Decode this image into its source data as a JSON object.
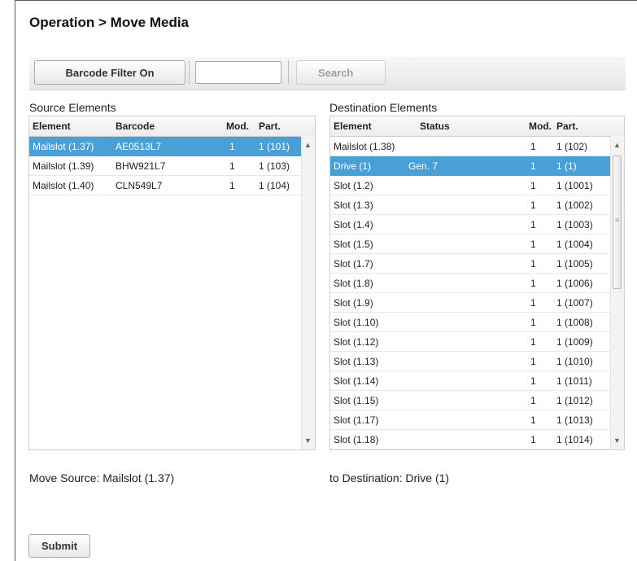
{
  "page": {
    "title": "Operation > Move Media"
  },
  "toolbar": {
    "filter_button": "Barcode Filter On",
    "search_value": "",
    "search_button": "Search"
  },
  "source": {
    "label": "Source Elements",
    "columns": [
      "Element",
      "Barcode",
      "Mod.",
      "Part."
    ],
    "rows": [
      {
        "element": "Mailslot (1.37)",
        "barcode": "AE0513L7",
        "mod": "1",
        "part": "1 (101)",
        "selected": true
      },
      {
        "element": "Mailslot (1.39)",
        "barcode": "BHW921L7",
        "mod": "1",
        "part": "1 (103)",
        "selected": false
      },
      {
        "element": "Mailslot (1.40)",
        "barcode": "CLN549L7",
        "mod": "1",
        "part": "1 (104)",
        "selected": false
      }
    ]
  },
  "destination": {
    "label": "Destination Elements",
    "columns": [
      "Element",
      "Status",
      "Mod.",
      "Part."
    ],
    "rows": [
      {
        "element": "Mailslot (1.38)",
        "status": "",
        "mod": "1",
        "part": "1 (102)",
        "selected": false
      },
      {
        "element": "Drive (1)",
        "status": "Gen. 7",
        "mod": "1",
        "part": "1 (1)",
        "selected": true
      },
      {
        "element": "Slot (1.2)",
        "status": "",
        "mod": "1",
        "part": "1 (1001)",
        "selected": false
      },
      {
        "element": "Slot (1.3)",
        "status": "",
        "mod": "1",
        "part": "1 (1002)",
        "selected": false
      },
      {
        "element": "Slot (1.4)",
        "status": "",
        "mod": "1",
        "part": "1 (1003)",
        "selected": false
      },
      {
        "element": "Slot (1.5)",
        "status": "",
        "mod": "1",
        "part": "1 (1004)",
        "selected": false
      },
      {
        "element": "Slot (1.7)",
        "status": "",
        "mod": "1",
        "part": "1 (1005)",
        "selected": false
      },
      {
        "element": "Slot (1.8)",
        "status": "",
        "mod": "1",
        "part": "1 (1006)",
        "selected": false
      },
      {
        "element": "Slot (1.9)",
        "status": "",
        "mod": "1",
        "part": "1 (1007)",
        "selected": false
      },
      {
        "element": "Slot (1.10)",
        "status": "",
        "mod": "1",
        "part": "1 (1008)",
        "selected": false
      },
      {
        "element": "Slot (1.12)",
        "status": "",
        "mod": "1",
        "part": "1 (1009)",
        "selected": false
      },
      {
        "element": "Slot (1.13)",
        "status": "",
        "mod": "1",
        "part": "1 (1010)",
        "selected": false
      },
      {
        "element": "Slot (1.14)",
        "status": "",
        "mod": "1",
        "part": "1 (1011)",
        "selected": false
      },
      {
        "element": "Slot (1.15)",
        "status": "",
        "mod": "1",
        "part": "1 (1012)",
        "selected": false
      },
      {
        "element": "Slot (1.17)",
        "status": "",
        "mod": "1",
        "part": "1 (1013)",
        "selected": false
      },
      {
        "element": "Slot (1.18)",
        "status": "",
        "mod": "1",
        "part": "1 (1014)",
        "selected": false
      }
    ]
  },
  "move": {
    "source_text": "Move Source: Mailslot (1.37)",
    "destination_text": "to Destination: Drive (1)"
  },
  "submit_label": "Submit",
  "colors": {
    "selection": "#4a9fd6",
    "toolbar": "#ececec"
  },
  "icons": {
    "scroll_up": "up-arrow-icon",
    "scroll_down": "down-arrow-icon",
    "grip": "scroll-grip-icon"
  }
}
